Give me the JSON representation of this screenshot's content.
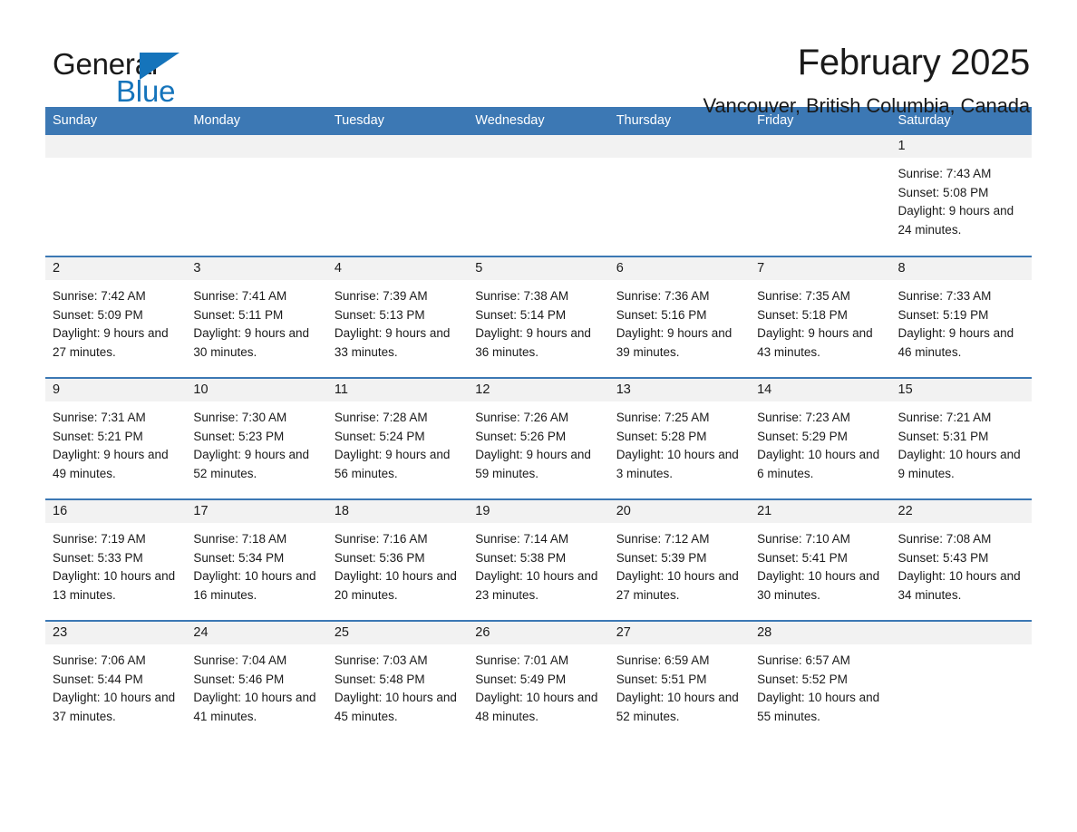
{
  "brand": {
    "name_part1": "General",
    "name_part2": "Blue",
    "accent_color": "#1574bb"
  },
  "header": {
    "title": "February 2025",
    "subtitle": "Vancouver, British Columbia, Canada"
  },
  "theme": {
    "header_blue": "#3c78b4",
    "band_gray": "#f2f2f2",
    "text": "#1a1a1a"
  },
  "weekdays": [
    "Sunday",
    "Monday",
    "Tuesday",
    "Wednesday",
    "Thursday",
    "Friday",
    "Saturday"
  ],
  "weeks": [
    [
      {
        "empty": true
      },
      {
        "empty": true
      },
      {
        "empty": true
      },
      {
        "empty": true
      },
      {
        "empty": true
      },
      {
        "empty": true
      },
      {
        "day": "1",
        "sunrise": "Sunrise: 7:43 AM",
        "sunset": "Sunset: 5:08 PM",
        "daylight": "Daylight: 9 hours and 24 minutes."
      }
    ],
    [
      {
        "day": "2",
        "sunrise": "Sunrise: 7:42 AM",
        "sunset": "Sunset: 5:09 PM",
        "daylight": "Daylight: 9 hours and 27 minutes."
      },
      {
        "day": "3",
        "sunrise": "Sunrise: 7:41 AM",
        "sunset": "Sunset: 5:11 PM",
        "daylight": "Daylight: 9 hours and 30 minutes."
      },
      {
        "day": "4",
        "sunrise": "Sunrise: 7:39 AM",
        "sunset": "Sunset: 5:13 PM",
        "daylight": "Daylight: 9 hours and 33 minutes."
      },
      {
        "day": "5",
        "sunrise": "Sunrise: 7:38 AM",
        "sunset": "Sunset: 5:14 PM",
        "daylight": "Daylight: 9 hours and 36 minutes."
      },
      {
        "day": "6",
        "sunrise": "Sunrise: 7:36 AM",
        "sunset": "Sunset: 5:16 PM",
        "daylight": "Daylight: 9 hours and 39 minutes."
      },
      {
        "day": "7",
        "sunrise": "Sunrise: 7:35 AM",
        "sunset": "Sunset: 5:18 PM",
        "daylight": "Daylight: 9 hours and 43 minutes."
      },
      {
        "day": "8",
        "sunrise": "Sunrise: 7:33 AM",
        "sunset": "Sunset: 5:19 PM",
        "daylight": "Daylight: 9 hours and 46 minutes."
      }
    ],
    [
      {
        "day": "9",
        "sunrise": "Sunrise: 7:31 AM",
        "sunset": "Sunset: 5:21 PM",
        "daylight": "Daylight: 9 hours and 49 minutes."
      },
      {
        "day": "10",
        "sunrise": "Sunrise: 7:30 AM",
        "sunset": "Sunset: 5:23 PM",
        "daylight": "Daylight: 9 hours and 52 minutes."
      },
      {
        "day": "11",
        "sunrise": "Sunrise: 7:28 AM",
        "sunset": "Sunset: 5:24 PM",
        "daylight": "Daylight: 9 hours and 56 minutes."
      },
      {
        "day": "12",
        "sunrise": "Sunrise: 7:26 AM",
        "sunset": "Sunset: 5:26 PM",
        "daylight": "Daylight: 9 hours and 59 minutes."
      },
      {
        "day": "13",
        "sunrise": "Sunrise: 7:25 AM",
        "sunset": "Sunset: 5:28 PM",
        "daylight": "Daylight: 10 hours and 3 minutes."
      },
      {
        "day": "14",
        "sunrise": "Sunrise: 7:23 AM",
        "sunset": "Sunset: 5:29 PM",
        "daylight": "Daylight: 10 hours and 6 minutes."
      },
      {
        "day": "15",
        "sunrise": "Sunrise: 7:21 AM",
        "sunset": "Sunset: 5:31 PM",
        "daylight": "Daylight: 10 hours and 9 minutes."
      }
    ],
    [
      {
        "day": "16",
        "sunrise": "Sunrise: 7:19 AM",
        "sunset": "Sunset: 5:33 PM",
        "daylight": "Daylight: 10 hours and 13 minutes."
      },
      {
        "day": "17",
        "sunrise": "Sunrise: 7:18 AM",
        "sunset": "Sunset: 5:34 PM",
        "daylight": "Daylight: 10 hours and 16 minutes."
      },
      {
        "day": "18",
        "sunrise": "Sunrise: 7:16 AM",
        "sunset": "Sunset: 5:36 PM",
        "daylight": "Daylight: 10 hours and 20 minutes."
      },
      {
        "day": "19",
        "sunrise": "Sunrise: 7:14 AM",
        "sunset": "Sunset: 5:38 PM",
        "daylight": "Daylight: 10 hours and 23 minutes."
      },
      {
        "day": "20",
        "sunrise": "Sunrise: 7:12 AM",
        "sunset": "Sunset: 5:39 PM",
        "daylight": "Daylight: 10 hours and 27 minutes."
      },
      {
        "day": "21",
        "sunrise": "Sunrise: 7:10 AM",
        "sunset": "Sunset: 5:41 PM",
        "daylight": "Daylight: 10 hours and 30 minutes."
      },
      {
        "day": "22",
        "sunrise": "Sunrise: 7:08 AM",
        "sunset": "Sunset: 5:43 PM",
        "daylight": "Daylight: 10 hours and 34 minutes."
      }
    ],
    [
      {
        "day": "23",
        "sunrise": "Sunrise: 7:06 AM",
        "sunset": "Sunset: 5:44 PM",
        "daylight": "Daylight: 10 hours and 37 minutes."
      },
      {
        "day": "24",
        "sunrise": "Sunrise: 7:04 AM",
        "sunset": "Sunset: 5:46 PM",
        "daylight": "Daylight: 10 hours and 41 minutes."
      },
      {
        "day": "25",
        "sunrise": "Sunrise: 7:03 AM",
        "sunset": "Sunset: 5:48 PM",
        "daylight": "Daylight: 10 hours and 45 minutes."
      },
      {
        "day": "26",
        "sunrise": "Sunrise: 7:01 AM",
        "sunset": "Sunset: 5:49 PM",
        "daylight": "Daylight: 10 hours and 48 minutes."
      },
      {
        "day": "27",
        "sunrise": "Sunrise: 6:59 AM",
        "sunset": "Sunset: 5:51 PM",
        "daylight": "Daylight: 10 hours and 52 minutes."
      },
      {
        "day": "28",
        "sunrise": "Sunrise: 6:57 AM",
        "sunset": "Sunset: 5:52 PM",
        "daylight": "Daylight: 10 hours and 55 minutes."
      },
      {
        "empty": true
      }
    ]
  ]
}
